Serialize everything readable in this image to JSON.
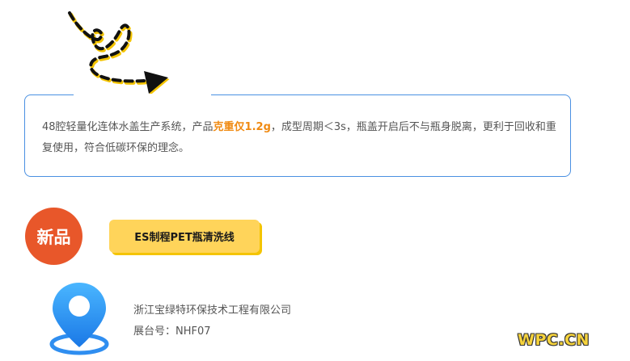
{
  "description": {
    "before_highlight": "48腔轻量化连体水盖生产系统，产品",
    "highlight": "克重仅1.2g",
    "after_highlight": "，成型周期＜3s，瓶盖开启后不与瓶身脱离，更利于回收和重复使用，符合低碳环保的理念。"
  },
  "badge": {
    "label": "新品"
  },
  "product": {
    "name": "ES制程PET瓶清洗线"
  },
  "exhibitor": {
    "company": "浙江宝绿特环保技术工程有限公司",
    "booth": "展台号：NHF07"
  },
  "watermark": {
    "text": "WPC.CN"
  },
  "colors": {
    "card_border": "#4a90e2",
    "highlight": "#f08a12",
    "badge_bg": "#e8572a",
    "tag_bg": "#ffd45a",
    "icon_blue": "#2f8ef0"
  },
  "icons": {
    "arrow": "dashed-curly-arrow-icon",
    "location": "location-pin-icon"
  }
}
